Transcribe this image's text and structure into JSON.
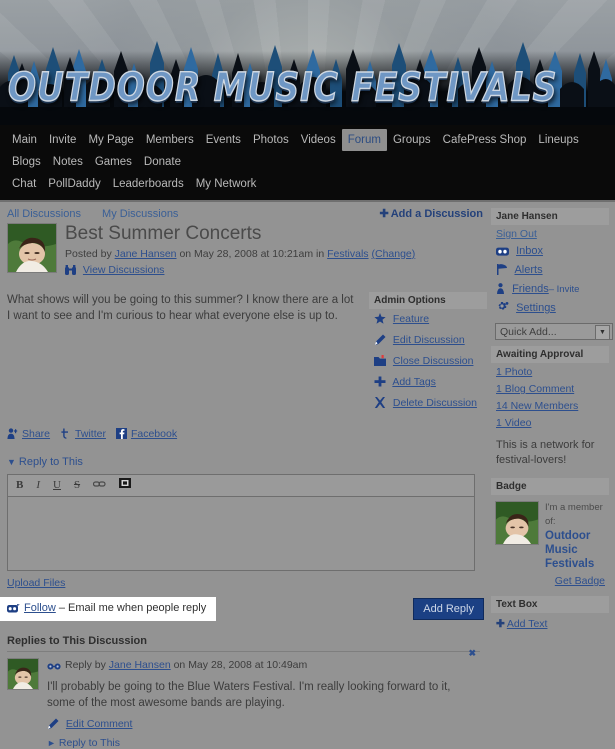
{
  "banner": {
    "site_title": "OUTDOOR MUSIC FESTIVALS"
  },
  "nav": {
    "row1": [
      {
        "label": "Main",
        "active": false
      },
      {
        "label": "Invite",
        "active": false
      },
      {
        "label": "My Page",
        "active": false
      },
      {
        "label": "Members",
        "active": false
      },
      {
        "label": "Events",
        "active": false
      },
      {
        "label": "Photos",
        "active": false
      },
      {
        "label": "Videos",
        "active": false
      },
      {
        "label": "Forum",
        "active": true
      },
      {
        "label": "Groups",
        "active": false
      },
      {
        "label": "CafePress Shop",
        "active": false
      },
      {
        "label": "Lineups",
        "active": false
      },
      {
        "label": "Blogs",
        "active": false
      },
      {
        "label": "Notes",
        "active": false
      },
      {
        "label": "Games",
        "active": false
      },
      {
        "label": "Donate",
        "active": false
      }
    ],
    "row2": [
      {
        "label": "Chat",
        "active": false
      },
      {
        "label": "PollDaddy",
        "active": false
      },
      {
        "label": "Leaderboards",
        "active": false
      },
      {
        "label": "My Network",
        "active": false
      }
    ]
  },
  "discussion_tabs": {
    "all": "All Discussions",
    "mine": "My Discussions",
    "add": "Add a Discussion"
  },
  "post": {
    "title": "Best Summer Concerts",
    "meta_prefix": "Posted by",
    "author": "Jane Hansen",
    "meta_mid": "on May 28, 2008 at 10:21am in",
    "category": "Festivals",
    "change": "(Change)",
    "view_discussions": "View Discussions",
    "body": "What shows will you be going to this summer? I know there are a lot I want to see and I'm curious to hear what everyone else is up to."
  },
  "admin_options": {
    "title": "Admin Options",
    "items": [
      {
        "label": "Feature",
        "icon": "star-icon"
      },
      {
        "label": "Edit Discussion",
        "icon": "pencil-icon"
      },
      {
        "label": "Close Discussion",
        "icon": "folder-icon"
      },
      {
        "label": "Add Tags",
        "icon": "plus-icon"
      },
      {
        "label": "Delete Discussion",
        "icon": "x-icon"
      }
    ]
  },
  "share": {
    "share": "Share",
    "twitter": "Twitter",
    "facebook": "Facebook"
  },
  "reply_form": {
    "toggle_label": "Reply to This",
    "toolbar": [
      {
        "label": "B",
        "name": "bold-button"
      },
      {
        "label": "I",
        "name": "italic-button"
      },
      {
        "label": "U",
        "name": "underline-button"
      },
      {
        "label": "S",
        "name": "strikethrough-button"
      },
      {
        "label": "link-icon",
        "name": "link-button"
      },
      {
        "label": "image-icon",
        "name": "image-button"
      }
    ],
    "textarea_value": "",
    "upload_files": "Upload Files",
    "follow_link": "Follow",
    "follow_text": "– Email me when people reply",
    "add_reply": "Add Reply"
  },
  "replies": {
    "heading": "Replies to This Discussion",
    "items": [
      {
        "prefix": "Reply by",
        "author": "Jane Hansen",
        "timestamp": "on May 28, 2008 at 10:49am",
        "text": "I'll probably be going to the Blue Waters Festival. I'm really looking forward to it, some of the most awesome bands are playing.",
        "edit_label": "Edit Comment",
        "reply_label": "Reply to This",
        "close_label": "x"
      }
    ]
  },
  "sidebar": {
    "user": {
      "name": "Jane Hansen",
      "sign_out": "Sign Out",
      "links": [
        {
          "label": "Inbox",
          "icon": "envelope-icon"
        },
        {
          "label": "Alerts",
          "icon": "flag-icon"
        },
        {
          "label": "Friends",
          "icon": "person-icon",
          "sub": "– Invite"
        },
        {
          "label": "Settings",
          "icon": "gear-icon"
        }
      ],
      "quick_add": "Quick Add..."
    },
    "awaiting": {
      "title": "Awaiting Approval",
      "items": [
        {
          "label": "1 Photo"
        },
        {
          "label": "1 Blog Comment"
        },
        {
          "label": "14 New Members"
        },
        {
          "label": "1 Video"
        }
      ]
    },
    "description": "This is a network for festival-lovers!",
    "badge": {
      "title": "Badge",
      "line1": "I'm a member of:",
      "line2": "Outdoor Music Festivals",
      "get_badge": "Get Badge"
    },
    "text_box": {
      "title": "Text Box",
      "add_text": "Add Text"
    }
  },
  "colors": {
    "accent_blue": "#2d4f8e",
    "button_blue": "#1b4084",
    "page_bg": "#939393",
    "nav_bg": "#0a0a0a"
  }
}
